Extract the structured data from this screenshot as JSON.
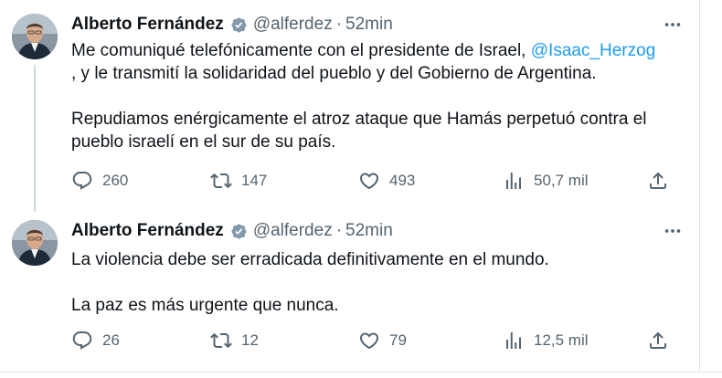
{
  "tweets": [
    {
      "author_name": "Alberto Fernández",
      "handle": "@alferdez",
      "separator": "·",
      "time": "52min",
      "text_before_mention": "Me comuniqué telefónicamente con el presidente de Israel, ",
      "mention": "@Isaac_Herzog",
      "text_after_mention": ", y le transmití la solidaridad del pueblo y del Gobierno de Argentina.",
      "paragraph_2": "Repudiamos enérgicamente el atroz ataque que Hamás perpetuó contra el pueblo israelí en el sur de su país.",
      "replies": "260",
      "reposts": "147",
      "likes": "493",
      "views": "50,7 mil"
    },
    {
      "author_name": "Alberto Fernández",
      "handle": "@alferdez",
      "separator": "·",
      "time": "52min",
      "paragraph_1": "La violencia debe ser erradicada definitivamente en el mundo.",
      "paragraph_2": "La paz es más urgente que nunca.",
      "replies": "26",
      "reposts": "12",
      "likes": "79",
      "views": "12,5 mil"
    }
  ],
  "colors": {
    "text": "#0f1419",
    "secondary": "#536471",
    "link": "#1d9bf0",
    "verified_badge": "#829aab"
  },
  "icons": {
    "verified": "verified-badge-icon",
    "more": "more-horizontal-icon",
    "reply": "reply-bubble-icon",
    "repost": "repost-arrows-icon",
    "like": "heart-icon",
    "views": "views-bar-chart-icon",
    "share": "share-upload-icon"
  }
}
